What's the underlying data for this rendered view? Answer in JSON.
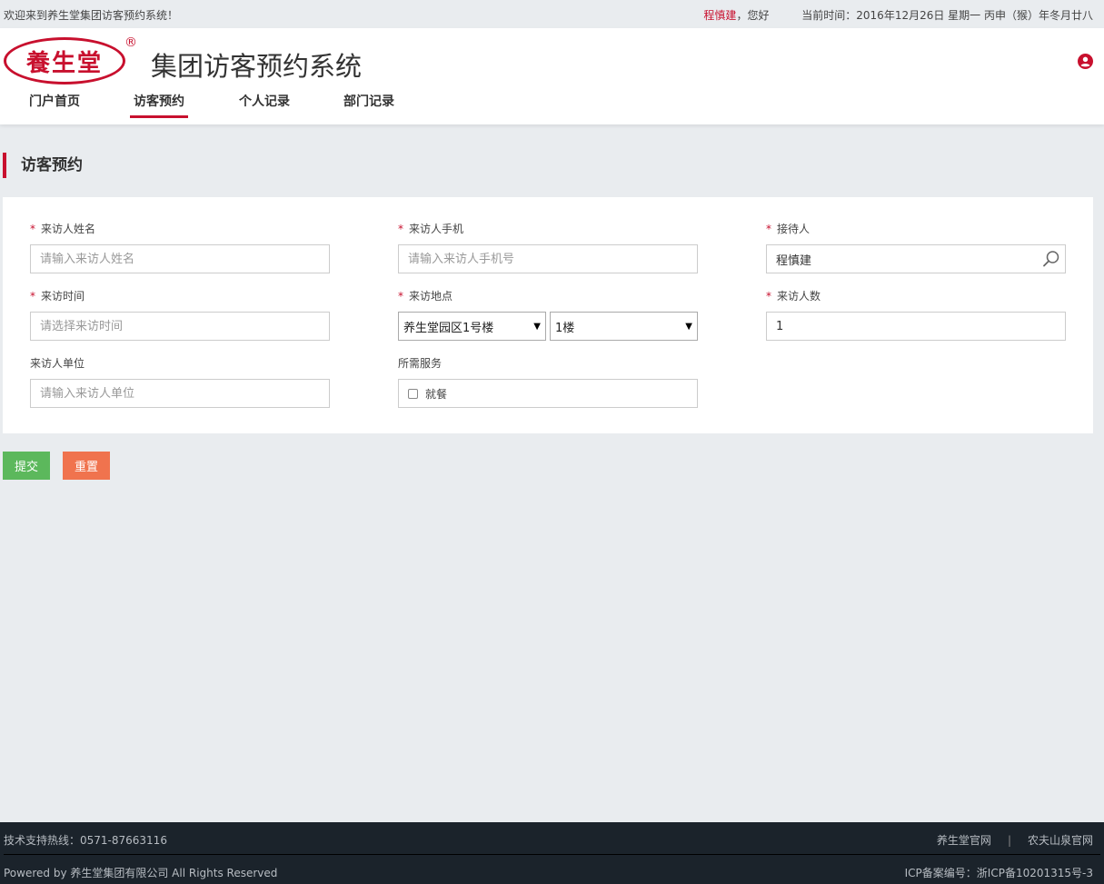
{
  "topbar": {
    "welcome": "欢迎来到养生堂集团访客预约系统！",
    "user": "程慎建",
    "greeting": "，您好",
    "datetime": "当前时间：2016年12月26日  星期一  丙申（猴）年冬月廿八"
  },
  "header": {
    "logo_text": "養生堂",
    "registered": "®",
    "title": "集团访客预约系统"
  },
  "nav": {
    "items": [
      {
        "label": "门户首页",
        "active": false
      },
      {
        "label": "访客预约",
        "active": true
      },
      {
        "label": "个人记录",
        "active": false
      },
      {
        "label": "部门记录",
        "active": false
      }
    ]
  },
  "section": {
    "title": "访客预约"
  },
  "form": {
    "visitor_name": {
      "label": "来访人姓名",
      "required": "*",
      "placeholder": "请输入来访人姓名"
    },
    "visitor_phone": {
      "label": "来访人手机",
      "required": "*",
      "placeholder": "请输入来访人手机号"
    },
    "host": {
      "label": "接待人",
      "required": "*",
      "value": "程慎建"
    },
    "visit_time": {
      "label": "来访时间",
      "required": "*",
      "placeholder": "请选择来访时间"
    },
    "visit_location": {
      "label": "来访地点",
      "required": "*",
      "building": "养生堂园区1号楼",
      "floor": "1楼"
    },
    "visitor_count": {
      "label": "来访人数",
      "required": "*",
      "value": "1"
    },
    "visitor_company": {
      "label": "来访人单位",
      "placeholder": "请输入来访人单位"
    },
    "services": {
      "label": "所需服务",
      "option": "就餐"
    }
  },
  "buttons": {
    "submit": "提交",
    "reset": "重置"
  },
  "footer": {
    "hotline": "技术支持热线：0571-87663116",
    "link1": "养生堂官网",
    "separator": "|",
    "link2": "农夫山泉官网",
    "copyright": "Powered by 养生堂集团有限公司 All Rights Reserved",
    "icp": "ICP备案编号：浙ICP备10201315号-3"
  },
  "colors": {
    "brand": "#c8102e",
    "submit": "#5cb85c",
    "reset": "#f0734e",
    "footer_bg": "#1b232b"
  }
}
